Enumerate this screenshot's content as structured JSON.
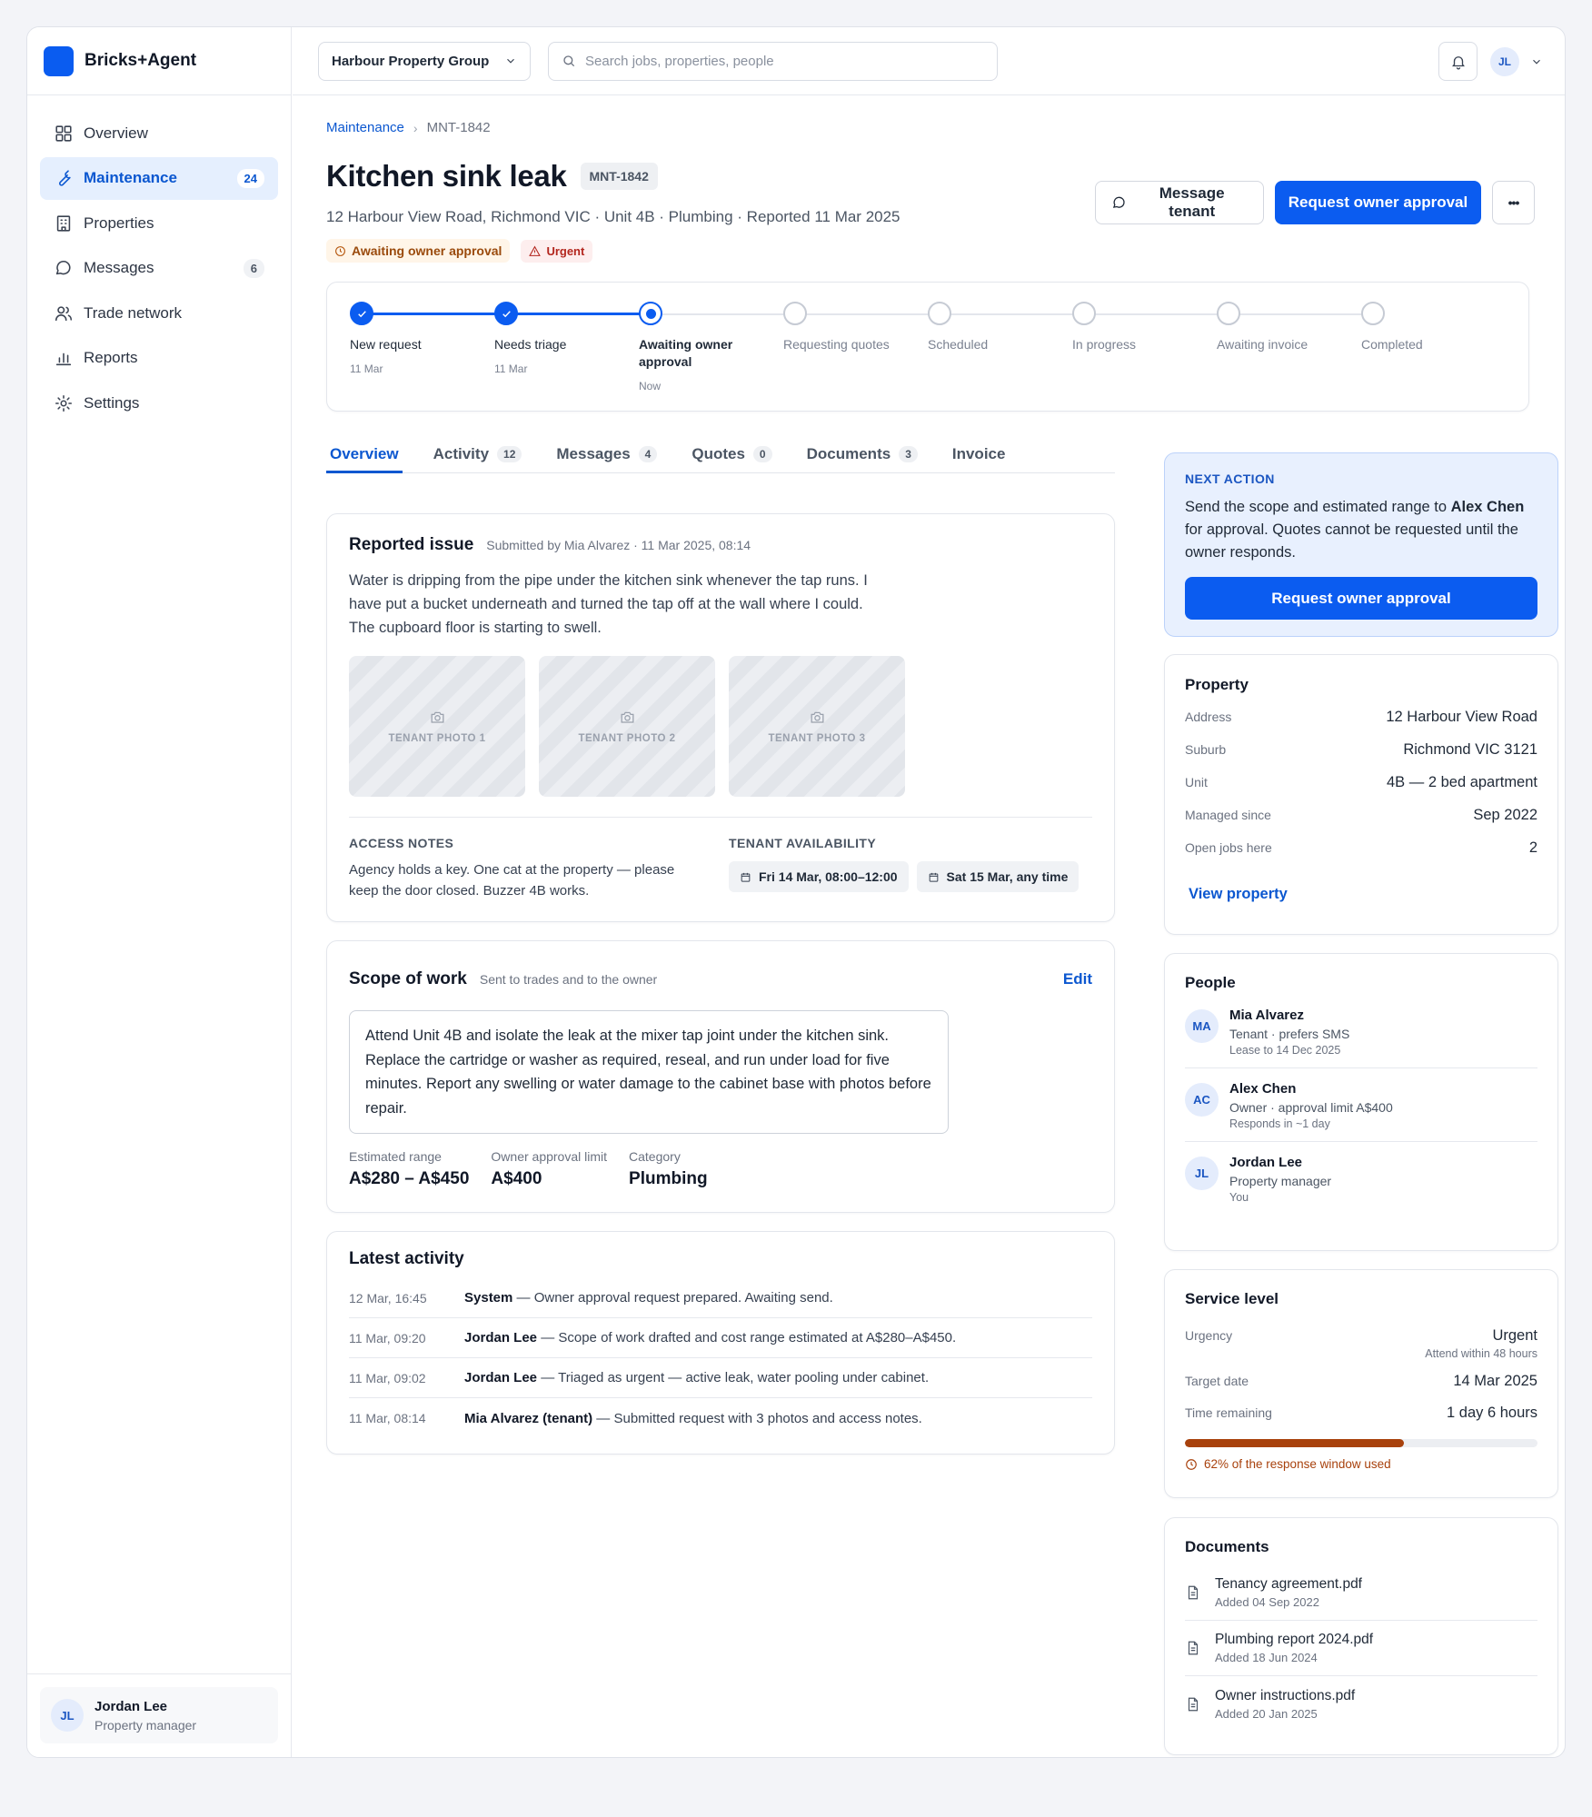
{
  "app": {
    "name": "Bricks+Agent"
  },
  "sidebar": {
    "items": [
      {
        "label": "Overview",
        "icon": "grid-icon",
        "count": ""
      },
      {
        "label": "Maintenance",
        "icon": "wrench-icon",
        "count": "24",
        "active": true
      },
      {
        "label": "Properties",
        "icon": "building-icon",
        "count": ""
      },
      {
        "label": "Messages",
        "icon": "chat-icon",
        "count": "6"
      },
      {
        "label": "Trade network",
        "icon": "people-icon",
        "count": ""
      },
      {
        "label": "Reports",
        "icon": "bar-chart-icon",
        "count": ""
      },
      {
        "label": "Settings",
        "icon": "gear-icon",
        "count": ""
      }
    ],
    "user": {
      "initials": "JL",
      "name": "Jordan Lee",
      "role": "Property manager"
    }
  },
  "topbar": {
    "org": "Harbour Property Group",
    "search_placeholder": "Search jobs, properties, people",
    "avatar_initials": "JL"
  },
  "breadcrumb": {
    "parent": "Maintenance",
    "current": "MNT-1842"
  },
  "job": {
    "title": "Kitchen sink leak",
    "id": "MNT-1842",
    "subtitle": "12 Harbour View Road, Richmond VIC · Unit 4B · Plumbing · Reported 11 Mar 2025",
    "status_badge": "Awaiting owner approval",
    "urgency_badge": "Urgent"
  },
  "actions": {
    "message_tenant": "Message tenant",
    "request_approval": "Request owner approval",
    "more": "•••"
  },
  "stepper": [
    {
      "label": "New request",
      "date": "11 Mar",
      "state": "done"
    },
    {
      "label": "Needs triage",
      "date": "11 Mar",
      "state": "done"
    },
    {
      "label": "Awaiting owner approval",
      "date": "Now",
      "state": "current"
    },
    {
      "label": "Requesting quotes",
      "date": "",
      "state": "todo"
    },
    {
      "label": "Scheduled",
      "date": "",
      "state": "todo"
    },
    {
      "label": "In progress",
      "date": "",
      "state": "todo"
    },
    {
      "label": "Awaiting invoice",
      "date": "",
      "state": "todo"
    },
    {
      "label": "Completed",
      "date": "",
      "state": "todo"
    }
  ],
  "tabs": [
    {
      "label": "Overview",
      "count": "",
      "active": true
    },
    {
      "label": "Activity",
      "count": "12"
    },
    {
      "label": "Messages",
      "count": "4"
    },
    {
      "label": "Quotes",
      "count": "0"
    },
    {
      "label": "Documents",
      "count": "3"
    },
    {
      "label": "Invoice",
      "count": ""
    }
  ],
  "issue": {
    "heading": "Reported issue",
    "submitted": "Submitted by Mia Alvarez · 11 Mar 2025, 08:14",
    "lines": [
      "Water is dripping from the pipe under the kitchen sink whenever the tap runs. I",
      "have put a bucket underneath and turned the tap off at the wall where I could.",
      "The cupboard floor is starting to swell."
    ],
    "photos": [
      "TENANT PHOTO 1",
      "TENANT PHOTO 2",
      "TENANT PHOTO 3"
    ],
    "access_label": "ACCESS NOTES",
    "access_lines": [
      "Agency holds a key. One cat at the property — please",
      "keep the door closed. Buzzer 4B works."
    ],
    "availability_label": "TENANT AVAILABILITY",
    "availability": [
      "Fri 14 Mar, 08:00–12:00",
      "Sat 15 Mar, any time"
    ]
  },
  "scope": {
    "heading": "Scope of work",
    "sub": "Sent to trades and to the owner",
    "edit": "Edit",
    "lines": [
      "Attend Unit 4B and isolate the leak at the mixer tap joint under the kitchen sink.",
      "Replace the cartridge or washer as required, reseal, and run under load for five",
      "minutes. Report any swelling or water damage to the cabinet base with photos before",
      "repair."
    ],
    "metrics": [
      {
        "label": "Estimated range",
        "value": "A$280 – A$450"
      },
      {
        "label": "Owner approval limit",
        "value": "A$400"
      },
      {
        "label": "Category",
        "value": "Plumbing"
      }
    ]
  },
  "activity": {
    "heading": "Latest activity",
    "rows": [
      {
        "time": "12 Mar, 16:45",
        "who": "System",
        "msg": " — Owner approval request prepared. Awaiting send."
      },
      {
        "time": "11 Mar, 09:20",
        "who": "Jordan Lee",
        "msg": " — Scope of work drafted and cost range estimated at A$280–A$450."
      },
      {
        "time": "11 Mar, 09:02",
        "who": "Jordan Lee",
        "msg": " — Triaged as urgent — active leak, water pooling under cabinet."
      },
      {
        "time": "11 Mar, 08:14",
        "who": "Mia Alvarez (tenant)",
        "msg": " — Submitted request with 3 photos and access notes."
      }
    ]
  },
  "next_action": {
    "label": "NEXT ACTION",
    "text_before": "Send the scope and estimated range to ",
    "owner": "Alex Chen",
    "text_line2": "for approval. Quotes cannot be requested until the",
    "text_line3": "owner responds.",
    "button": "Request owner approval"
  },
  "property": {
    "heading": "Property",
    "rows": [
      {
        "k": "Address",
        "v": "12 Harbour View Road"
      },
      {
        "k": "Suburb",
        "v": "Richmond VIC 3121"
      },
      {
        "k": "Unit",
        "v": "4B — 2 bed apartment"
      },
      {
        "k": "Managed since",
        "v": "Sep 2022"
      },
      {
        "k": "Open jobs here",
        "v": "2"
      }
    ],
    "link": "View property"
  },
  "people": {
    "heading": "People",
    "list": [
      {
        "initials": "MA",
        "name": "Mia Alvarez",
        "role": "Tenant · prefers SMS",
        "note": "Lease to 14 Dec 2025"
      },
      {
        "initials": "AC",
        "name": "Alex Chen",
        "role": "Owner · approval limit A$400",
        "note": "Responds in ~1 day"
      },
      {
        "initials": "JL",
        "name": "Jordan Lee",
        "role": "Property manager",
        "note": "You"
      }
    ]
  },
  "service": {
    "heading": "Service level",
    "urgency_k": "Urgency",
    "urgency_v": "Urgent",
    "urgency_note": "Attend within 48 hours",
    "target_k": "Target date",
    "target_v": "14 Mar 2025",
    "remaining_k": "Time remaining",
    "remaining_v": "1 day 6 hours",
    "progress_fraction": 0.62,
    "progress_text": "62% of the response window used",
    "progress_color": "#a8410c"
  },
  "documents": {
    "heading": "Documents",
    "list": [
      {
        "name": "Tenancy agreement.pdf",
        "date": "Added 04 Sep 2022"
      },
      {
        "name": "Plumbing report 2024.pdf",
        "date": "Added 18 Jun 2024"
      },
      {
        "name": "Owner instructions.pdf",
        "date": "Added 20 Jan 2025"
      }
    ]
  },
  "colors": {
    "accent": "#0b5cf0",
    "warning": "#b45309",
    "danger": "#b3261e"
  }
}
